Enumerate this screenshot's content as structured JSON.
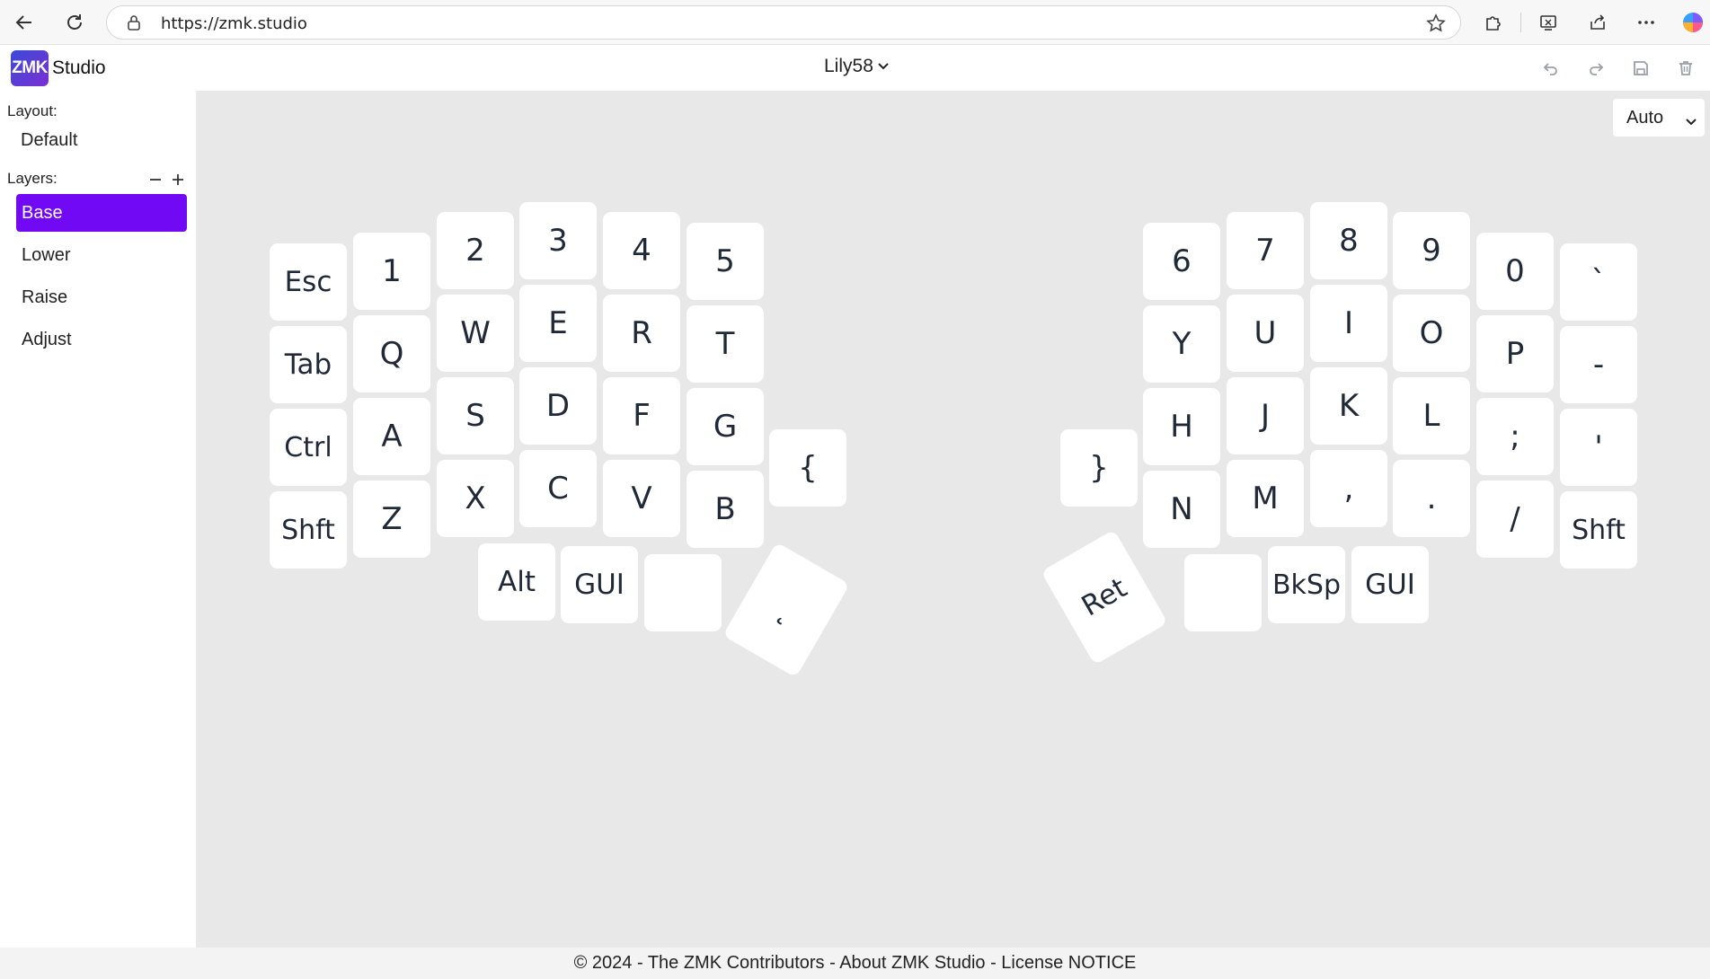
{
  "browser": {
    "url": "https://zmk.studio"
  },
  "app": {
    "logo_text": "ZMK",
    "brand": "Studio",
    "keyboard_name": "Lily58",
    "accent_color": "#7209f5"
  },
  "sidebar": {
    "layout_label": "Layout:",
    "layout_value": "Default",
    "layers_label": "Layers:",
    "layers": [
      {
        "label": "Base",
        "active": true
      },
      {
        "label": "Lower",
        "active": false
      },
      {
        "label": "Raise",
        "active": false
      },
      {
        "label": "Adjust",
        "active": false
      }
    ]
  },
  "main": {
    "view_mode": "Auto"
  },
  "keymap": {
    "left": {
      "row1": [
        "Esc",
        "1",
        "2",
        "3",
        "4",
        "5"
      ],
      "row2": [
        "Tab",
        "Q",
        "W",
        "E",
        "R",
        "T"
      ],
      "row3": [
        "Ctrl",
        "A",
        "S",
        "D",
        "F",
        "G"
      ],
      "row4": [
        "Shft",
        "Z",
        "X",
        "C",
        "V",
        "B"
      ],
      "inner": "{",
      "thumbs": [
        "Alt",
        "GUI",
        "",
        "˛"
      ]
    },
    "right": {
      "row1": [
        "6",
        "7",
        "8",
        "9",
        "0",
        "`"
      ],
      "row2": [
        "Y",
        "U",
        "I",
        "O",
        "P",
        "-"
      ],
      "row3": [
        "H",
        "J",
        "K",
        "L",
        ";",
        "'"
      ],
      "row4": [
        "N",
        "M",
        ",",
        ".",
        "/",
        "Shft"
      ],
      "inner": "}",
      "thumbs": [
        "Ret",
        "",
        "BkSp",
        "GUI"
      ]
    }
  },
  "footer": {
    "text": "© 2024 - The ZMK Contributors - About ZMK Studio - License NOTICE"
  }
}
